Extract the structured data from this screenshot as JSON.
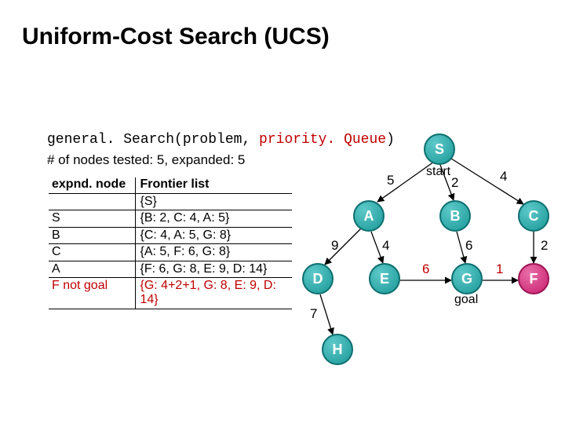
{
  "title": "Uniform-Cost Search (UCS)",
  "code_prefix": "general. Search(problem, ",
  "code_pq": "priority. Queue",
  "code_suffix": ")",
  "stats": "# of nodes tested: 5, expanded: 5",
  "table": {
    "col1": "expnd. node",
    "col2": "Frontier list",
    "rows": [
      {
        "n": "",
        "f": "{S}"
      },
      {
        "n": "S",
        "f": "{B: 2, C: 4, A: 5}"
      },
      {
        "n": "B",
        "f": "{C: 4, A: 5, G: 8}"
      },
      {
        "n": "C",
        "f": "{A: 5, F: 6, G: 8}"
      },
      {
        "n": "A",
        "f": "{F: 6, G: 8, E: 9, D: 14}"
      },
      {
        "n": "F not goal",
        "f": "{G: 4+2+1, G: 8, E: 9, D: 14}",
        "n_red": true,
        "f_red": true
      }
    ]
  },
  "graph": {
    "nodes": {
      "S": {
        "label": "S",
        "sub": "start"
      },
      "A": {
        "label": "A",
        "sub": ""
      },
      "B": {
        "label": "B",
        "sub": ""
      },
      "C": {
        "label": "C",
        "sub": ""
      },
      "D": {
        "label": "D",
        "sub": ""
      },
      "E": {
        "label": "E",
        "sub": ""
      },
      "G": {
        "label": "G",
        "sub": "goal"
      },
      "F": {
        "label": "F",
        "sub": ""
      },
      "H": {
        "label": "H",
        "sub": ""
      }
    },
    "edges": {
      "SA": "5",
      "SB": "2",
      "SC": "4",
      "AD": "9",
      "AE": "4",
      "BG": "6",
      "CF": "2",
      "EG": "6",
      "GF": "1",
      "DH": "7"
    }
  }
}
